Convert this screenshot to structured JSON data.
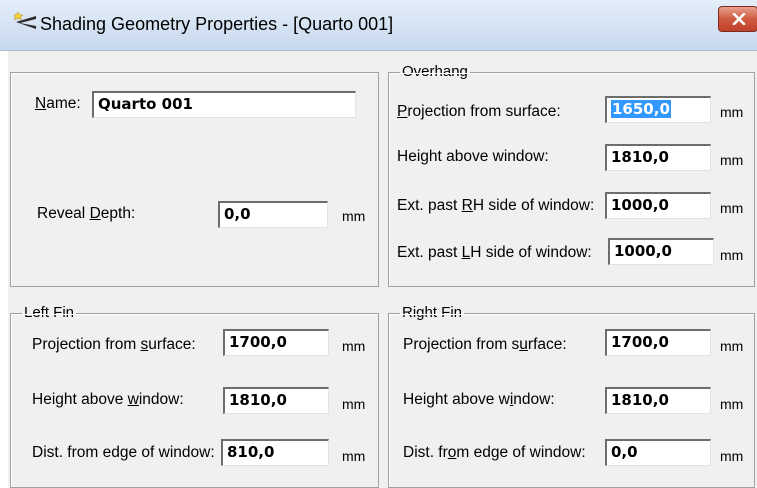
{
  "window": {
    "title": "Shading Geometry Properties - [Quarto 001]",
    "close_label": "×"
  },
  "general": {
    "name_label_pre": "",
    "name_label_u": "N",
    "name_label_post": "ame:",
    "name_value": "Quarto 001",
    "reveal_label_pre": "Reveal ",
    "reveal_label_u": "D",
    "reveal_label_post": "epth:",
    "reveal_value": "0,0",
    "unit": "mm"
  },
  "overhang": {
    "title": "Overhang",
    "projection_pre": "",
    "projection_u": "P",
    "projection_post": "rojection from surface:",
    "projection_value": "1650,0",
    "height_label": "Height above window:",
    "height_value": "1810,0",
    "ext_rh_pre": "Ext. past ",
    "ext_rh_u": "R",
    "ext_rh_post": "H side of window:",
    "ext_rh_value": "1000,0",
    "ext_lh_pre": "Ext. past ",
    "ext_lh_u": "L",
    "ext_lh_post": "H side of window:",
    "ext_lh_value": "1000,0",
    "unit": "mm"
  },
  "left_fin": {
    "title": "Left Fin",
    "projection_pre": "Projection from ",
    "projection_u": "s",
    "projection_post": "urface:",
    "projection_value": "1700,0",
    "height_pre": "Height above ",
    "height_u": "w",
    "height_post": "indow:",
    "height_value": "1810,0",
    "dist_label": "Dist. from edge of window:",
    "dist_value": "810,0",
    "unit": "mm"
  },
  "right_fin": {
    "title": "Right Fin",
    "projection_pre": "Projection from s",
    "projection_u": "u",
    "projection_post": "rface:",
    "projection_value": "1700,0",
    "height_pre": "Height above w",
    "height_u": "i",
    "height_post": "ndow:",
    "height_value": "1810,0",
    "dist_pre": "Dist. fr",
    "dist_u": "o",
    "dist_post": "m edge of window:",
    "dist_value": "0,0",
    "unit": "mm"
  }
}
